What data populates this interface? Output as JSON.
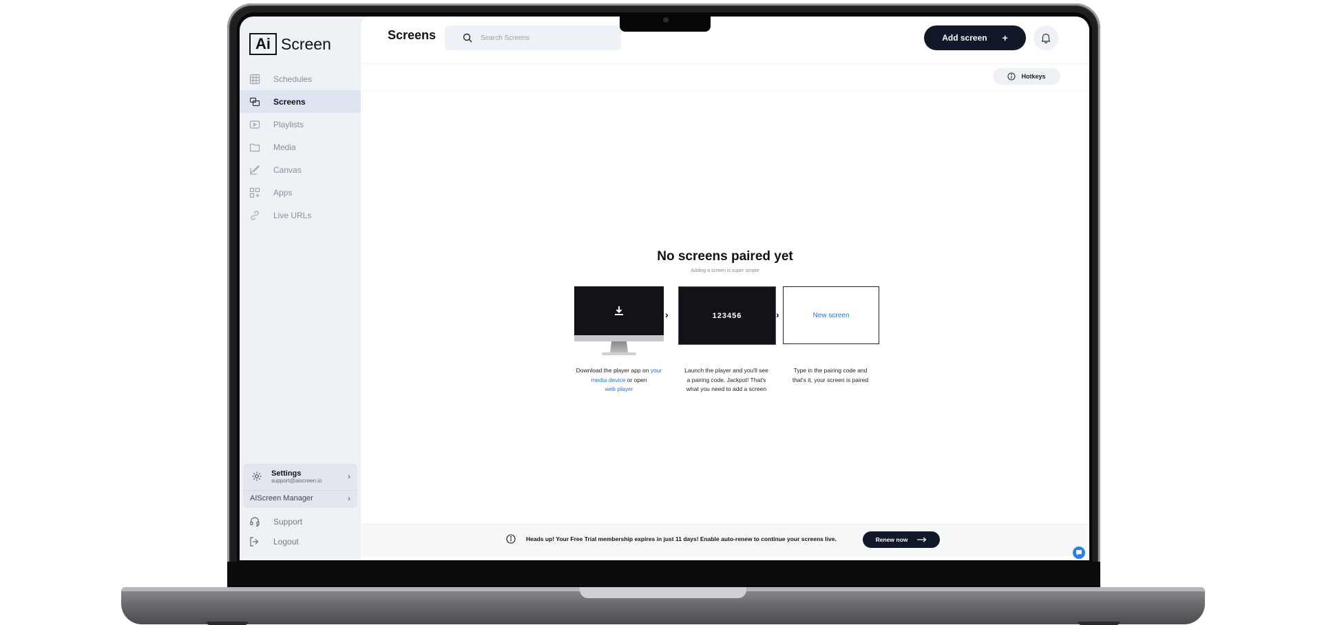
{
  "app": {
    "logo_boxed": "Ai",
    "logo_text": "Screen"
  },
  "sidebar": {
    "items": [
      {
        "label": "Schedules",
        "icon": "calendar-grid-icon",
        "active": false
      },
      {
        "label": "Screens",
        "icon": "screens-icon",
        "active": true
      },
      {
        "label": "Playlists",
        "icon": "playlist-icon",
        "active": false
      },
      {
        "label": "Media",
        "icon": "folder-icon",
        "active": false
      },
      {
        "label": "Canvas",
        "icon": "canvas-brush-icon",
        "active": false
      },
      {
        "label": "Apps",
        "icon": "apps-grid-icon",
        "active": false
      },
      {
        "label": "Live URLs",
        "icon": "link-icon",
        "active": false
      }
    ],
    "settings": {
      "title": "Settings",
      "email": "support@aiscreen.io"
    },
    "manager": "AIScreen Manager",
    "support": "Support",
    "logout": "Logout"
  },
  "header": {
    "title": "Screens",
    "search_placeholder": "Search Screens",
    "add_button": "Add screen",
    "hotkeys": "Hotkeys"
  },
  "empty_state": {
    "title": "No screens paired yet",
    "subtitle": "Adding a screen is super simple",
    "step1": {
      "pre": "Download the player app on ",
      "link1": "your media device",
      "mid": " or open ",
      "link2": "web player"
    },
    "step2": {
      "code": "123456",
      "text": "Launch the player and you'll see a pairing code. Jackpot! That's what you need to add a screen"
    },
    "step3": {
      "label": "New screen",
      "text": "Type in the pairing code and that's it, your screen is paired"
    }
  },
  "trial": {
    "message": "Heads up! Your Free Trial membership expires in just 11 days! Enable auto-renew to continue your screens live.",
    "button": "Renew now"
  },
  "colors": {
    "accent_dark": "#111827",
    "link_blue": "#2f6fdb",
    "sidebar_bg": "#eef1f6",
    "active_bg": "#dde5f1"
  }
}
